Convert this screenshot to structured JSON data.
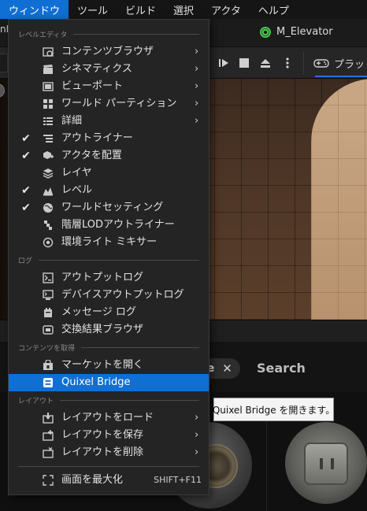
{
  "menubar": {
    "items": [
      {
        "label": "ウィンドウ",
        "active": true
      },
      {
        "label": "ツール"
      },
      {
        "label": "ビルド"
      },
      {
        "label": "選択"
      },
      {
        "label": "アクタ"
      },
      {
        "label": "ヘルプ"
      }
    ]
  },
  "tabs": {
    "left_stub": "nM",
    "level_tab": "M_Elevator"
  },
  "toolbar": {
    "platforms_label": "プラッ"
  },
  "content_browser": {
    "filter_chip": "le",
    "filter_chip_close": "✕",
    "search_label": "Search"
  },
  "window_menu": {
    "sections": {
      "level_editor": "レベルエディタ",
      "log": "ログ",
      "get_content": "コンテンツを取得",
      "layout": "レイアウト"
    },
    "items": {
      "content_browser": {
        "label": "コンテンツブラウザ",
        "icon": "content-browser-icon"
      },
      "cinematics": {
        "label": "シネマティクス",
        "icon": "clapperboard-icon"
      },
      "viewports": {
        "label": "ビューポート",
        "icon": "viewport-icon"
      },
      "world_partition": {
        "label": "ワールド パーティション",
        "icon": "grid-icon"
      },
      "details": {
        "label": "詳細",
        "icon": "details-icon"
      },
      "outliner": {
        "label": "アウトライナー",
        "icon": "outliner-icon",
        "checked": true
      },
      "place_actors": {
        "label": "アクタを配置",
        "icon": "place-actors-icon",
        "checked": true
      },
      "layers": {
        "label": "レイヤ",
        "icon": "layers-icon"
      },
      "levels": {
        "label": "レベル",
        "icon": "levels-icon",
        "checked": true
      },
      "world_settings": {
        "label": "ワールドセッティング",
        "icon": "globe-icon",
        "checked": true
      },
      "hlod_outliner": {
        "label": "階層LODアウトライナー",
        "icon": "hlod-icon"
      },
      "env_light_mixer": {
        "label": "環境ライト ミキサー",
        "icon": "light-mixer-icon"
      },
      "output_log": {
        "label": "アウトプットログ",
        "icon": "terminal-icon"
      },
      "device_output_log": {
        "label": "デバイスアウトプットログ",
        "icon": "device-log-icon"
      },
      "message_log": {
        "label": "メッセージ ログ",
        "icon": "message-log-icon"
      },
      "merge_browser": {
        "label": "交換結果ブラウザ",
        "icon": "merge-icon"
      },
      "open_marketplace": {
        "label": "マーケットを開く",
        "icon": "marketplace-icon"
      },
      "quixel_bridge": {
        "label": "Quixel Bridge",
        "icon": "bridge-icon",
        "highlighted": true
      },
      "load_layout": {
        "label": "レイアウトをロード",
        "icon": "load-layout-icon"
      },
      "save_layout": {
        "label": "レイアウトを保存",
        "icon": "save-layout-icon"
      },
      "remove_layout": {
        "label": "レイアウトを削除",
        "icon": "remove-layout-icon"
      },
      "maximize": {
        "label": "画面を最大化",
        "icon": "maximize-icon",
        "shortcut": "SHIFT+F11"
      }
    },
    "check_glyph": "✔",
    "submenu_arrow": "›"
  },
  "tooltip": {
    "text": "Quixel Bridge を開きます。"
  },
  "colors": {
    "accent": "#0f6fd4",
    "menu_bg": "#242424",
    "tooltip_bg": "#f4f4f4"
  }
}
